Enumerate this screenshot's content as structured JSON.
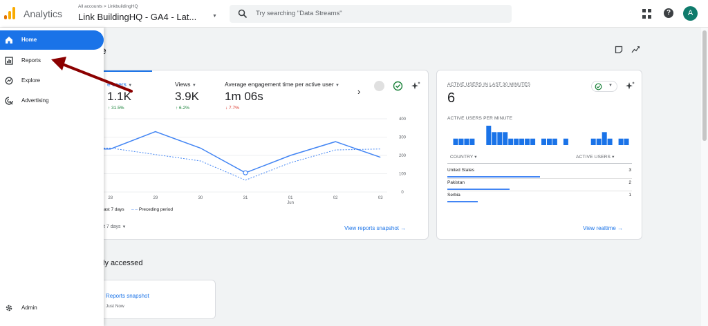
{
  "topbar": {
    "app_name": "Analytics",
    "breadcrumb": "All accounts > LinkbuildingHQ",
    "account_title": "Link BuildingHQ - GA4 - Lat...",
    "search_placeholder": "Try searching \"Data Streams\"",
    "avatar_letter": "A"
  },
  "sidebar": {
    "items": [
      {
        "label": "Home",
        "icon": "home-icon"
      },
      {
        "label": "Reports",
        "icon": "reports-icon"
      },
      {
        "label": "Explore",
        "icon": "explore-icon"
      },
      {
        "label": "Advertising",
        "icon": "advertising-icon"
      }
    ],
    "admin_label": "Admin"
  },
  "main": {
    "title_tail": "e",
    "metrics": [
      {
        "label": "e users",
        "value": "1.1K",
        "delta": "↑ 31.5%",
        "direction": "up"
      },
      {
        "label": "Views",
        "value": "3.9K",
        "delta": "↑ 6.2%",
        "direction": "up"
      },
      {
        "label": "Average engagement time per active user",
        "value": "1m 06s",
        "delta": "↓ 7.7%",
        "direction": "down"
      }
    ],
    "legend_current": "ast 7 days",
    "legend_previous": "Preceding period",
    "date_range": "t 7 days",
    "view_snapshot_link": "View reports snapshot →",
    "recently_accessed_title": "tly accessed",
    "recent_card_title": "Reports snapshot",
    "recent_card_time": "Just Now"
  },
  "realtime": {
    "title": "ACTIVE USERS IN LAST 30 MINUTES",
    "value": "6",
    "per_minute_label": "ACTIVE USERS PER MINUTE",
    "col_country": "COUNTRY ▾",
    "col_users": "ACTIVE USERS ▾",
    "rows": [
      {
        "country": "United States",
        "value": "3",
        "share": 1.0
      },
      {
        "country": "Pakistan",
        "value": "2",
        "share": 0.67
      },
      {
        "country": "Serbia",
        "value": "1",
        "share": 0.33
      }
    ],
    "per_minute_bars": [
      1,
      1,
      1,
      1,
      0,
      0,
      3,
      2,
      2,
      2,
      1,
      1,
      1,
      1,
      1,
      0,
      1,
      1,
      1,
      0,
      1,
      0,
      0,
      0,
      0,
      1,
      1,
      2,
      1,
      0,
      1,
      1
    ],
    "view_realtime_link": "View realtime →"
  },
  "chart_data": {
    "type": "line",
    "x": [
      "28",
      "29",
      "30",
      "31",
      "01 Jun",
      "02",
      "03"
    ],
    "series": [
      {
        "name": "ast 7 days",
        "style": "solid",
        "values": [
          235,
          330,
          240,
          105,
          200,
          275,
          190
        ]
      },
      {
        "name": "Preceding period",
        "style": "dotted",
        "values": [
          240,
          205,
          170,
          65,
          160,
          230,
          235
        ]
      }
    ],
    "yticks": [
      "400",
      "300",
      "200",
      "100",
      "0"
    ],
    "ylim": [
      0,
      400
    ]
  },
  "colors": {
    "accent": "#1a73e8",
    "line": "#4285f4",
    "up": "#188038",
    "down": "#d93025",
    "arrow": "#8b0000"
  }
}
